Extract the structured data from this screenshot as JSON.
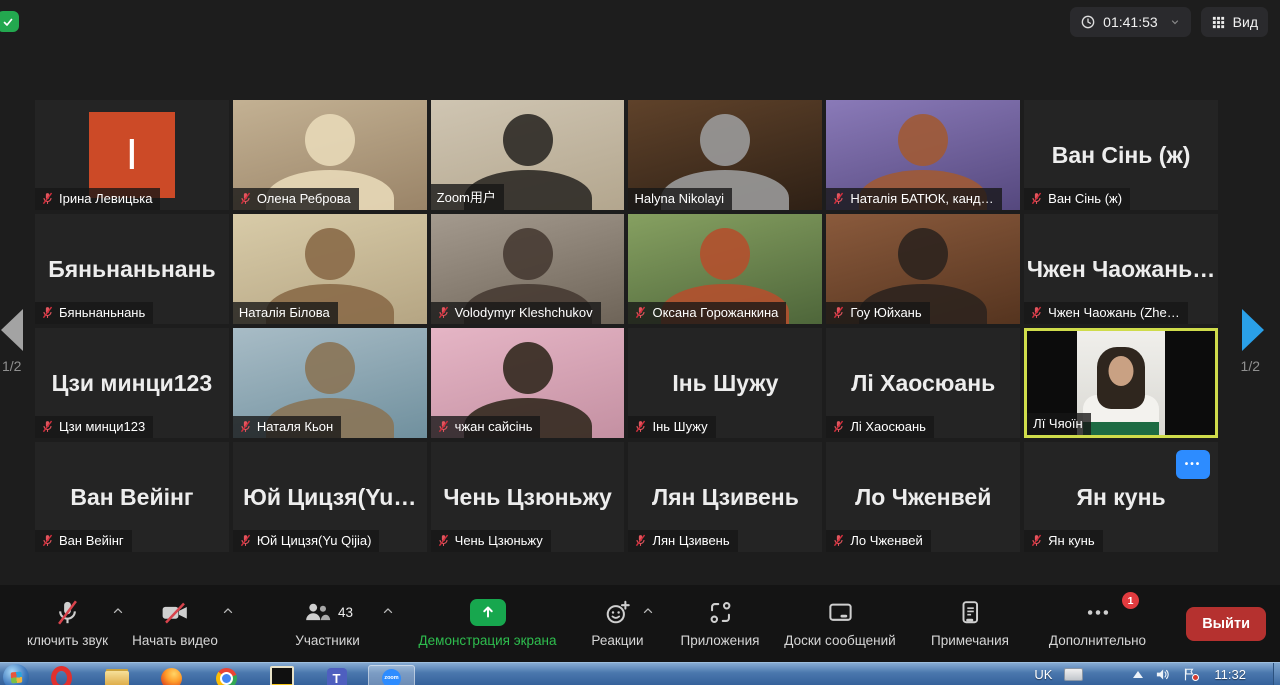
{
  "topbar": {
    "timer": "01:41:53",
    "view_label": "Вид",
    "icons": [
      "encryption-shield-icon",
      "clock-icon",
      "caret-down-icon",
      "grid-view-icon"
    ]
  },
  "pagination": {
    "left": "1/2",
    "right": "1/2"
  },
  "tiles": [
    {
      "label": "Ірина Левицька",
      "muted": true,
      "type": "letter",
      "letter": "І",
      "avatar_color": "#cc4a27"
    },
    {
      "label": "Олена Реброва",
      "muted": true,
      "type": "photo",
      "bg": [
        "#c3b193",
        "#9a8468"
      ],
      "person": "#e8d9b8"
    },
    {
      "label": "Zoom用户",
      "muted": false,
      "type": "photo",
      "bg": [
        "#cfc5b2",
        "#b3a68e"
      ],
      "person": "#2e2a26"
    },
    {
      "label": "Halyna Nikolayi",
      "muted": false,
      "type": "photo",
      "bg": [
        "#5f422a",
        "#2e2015"
      ],
      "person": "#9a9a9a"
    },
    {
      "label": "Наталія БАТЮК, канд…",
      "muted": true,
      "type": "photo",
      "bg": [
        "#8a7ab8",
        "#55487e"
      ],
      "person": "#a05a35"
    },
    {
      "label": "Ван Сінь (ж)",
      "muted": true,
      "type": "text",
      "text": "Ван Сінь (ж)"
    },
    {
      "label": "Бяньнаньнань",
      "muted": true,
      "type": "text",
      "text": "Бяньнаньнань"
    },
    {
      "label": "Наталія Білова",
      "muted": false,
      "type": "photo",
      "bg": [
        "#d8cba8",
        "#b5a583"
      ],
      "person": "#8a6a48"
    },
    {
      "label": "Volodymyr Kleshchukov",
      "muted": true,
      "type": "photo",
      "bg": [
        "#a49a8e",
        "#6e6458"
      ],
      "person": "#473b33"
    },
    {
      "label": "Оксана Горожанкина",
      "muted": true,
      "type": "photo",
      "bg": [
        "#86a061",
        "#4e663a"
      ],
      "person": "#b3502e"
    },
    {
      "label": "Гоу Юйхань",
      "muted": true,
      "type": "photo",
      "bg": [
        "#8a5a3c",
        "#55341f"
      ],
      "person": "#2e241e"
    },
    {
      "label": "Чжен Чаожань (Zhe…",
      "muted": true,
      "type": "text",
      "text": "Чжен Чаожань…"
    },
    {
      "label": "Цзи минци123",
      "muted": true,
      "type": "text",
      "text": "Цзи минци123"
    },
    {
      "label": "Наталя Кьон",
      "muted": true,
      "type": "photo",
      "bg": [
        "#a8bcc6",
        "#70909e"
      ],
      "person": "#8a7456"
    },
    {
      "label": "чжан сайсінь",
      "muted": true,
      "type": "photo",
      "bg": [
        "#e5b5c5",
        "#c490a2"
      ],
      "person": "#33291f"
    },
    {
      "label": "Інь Шужу",
      "muted": true,
      "type": "text",
      "text": "Інь Шужу"
    },
    {
      "label": "Лі Хаосюань",
      "muted": true,
      "type": "text",
      "text": "Лі Хаосюань"
    },
    {
      "label": "Лї Чяоїн",
      "muted": false,
      "type": "video-active",
      "active": true
    },
    {
      "label": "Ван Вейінг",
      "muted": true,
      "type": "text",
      "text": "Ван Вейінг"
    },
    {
      "label": "Юй Цицзя(Yu Qijia)",
      "muted": true,
      "type": "text",
      "text": "Юй Цицзя(Yu…"
    },
    {
      "label": "Чень Цзюньжу",
      "muted": true,
      "type": "text",
      "text": "Чень Цзюньжу"
    },
    {
      "label": "Лян Цзивень",
      "muted": true,
      "type": "text",
      "text": "Лян Цзивень"
    },
    {
      "label": "Ло Чженвей",
      "muted": true,
      "type": "text",
      "text": "Ло Чженвей"
    },
    {
      "label": "Ян кунь",
      "muted": true,
      "type": "text",
      "text": "Ян кунь",
      "more_button": true
    }
  ],
  "toolbar": {
    "items": [
      {
        "id": "mute",
        "label": "ключить звук",
        "icon": "mic-muted-icon",
        "chevron": true
      },
      {
        "id": "video",
        "label": "Начать видео",
        "icon": "video-muted-icon",
        "chevron": true
      },
      {
        "id": "participants",
        "label": "Участники",
        "icon": "participants-icon",
        "count": "43",
        "chevron": true
      },
      {
        "id": "share",
        "label": "Демонстрация экрана",
        "icon": "share-screen-icon",
        "green": true
      },
      {
        "id": "reactions",
        "label": "Реакции",
        "icon": "reactions-icon",
        "chevron": true
      },
      {
        "id": "apps",
        "label": "Приложения",
        "icon": "apps-icon"
      },
      {
        "id": "whiteboards",
        "label": "Доски сообщений",
        "icon": "whiteboard-icon"
      },
      {
        "id": "notes",
        "label": "Примечания",
        "icon": "notes-icon"
      },
      {
        "id": "more",
        "label": "Дополнительно",
        "icon": "more-dots-icon",
        "badge": "1"
      }
    ],
    "leave_label": "Выйти"
  },
  "colors": {
    "share_green": "#17a74e",
    "share_label_green": "#2ebd4e",
    "leave_red": "#b5312f",
    "active_border": "#cfdc4b",
    "muted_mic_red": "#e0565e",
    "tile_more_blue": "#2d8cff",
    "avatar_orange": "#cc4a27"
  },
  "taskbar": {
    "language": "UK",
    "time": "11:32",
    "apps": [
      {
        "id": "start",
        "name": "windows-start-icon"
      },
      {
        "id": "opera",
        "name": "opera-icon"
      },
      {
        "id": "explorer",
        "name": "file-explorer-icon"
      },
      {
        "id": "firefox",
        "name": "firefox-icon"
      },
      {
        "id": "chrome",
        "name": "chrome-icon"
      },
      {
        "id": "thebat",
        "name": "thebat-mail-icon"
      },
      {
        "id": "teams",
        "name": "teams-icon"
      },
      {
        "id": "zoom",
        "name": "zoom-app-icon"
      }
    ],
    "tray_icons": [
      "keyboard-icon",
      "hidden-icons-chevron",
      "speaker-icon",
      "notification-flag-icon"
    ]
  }
}
